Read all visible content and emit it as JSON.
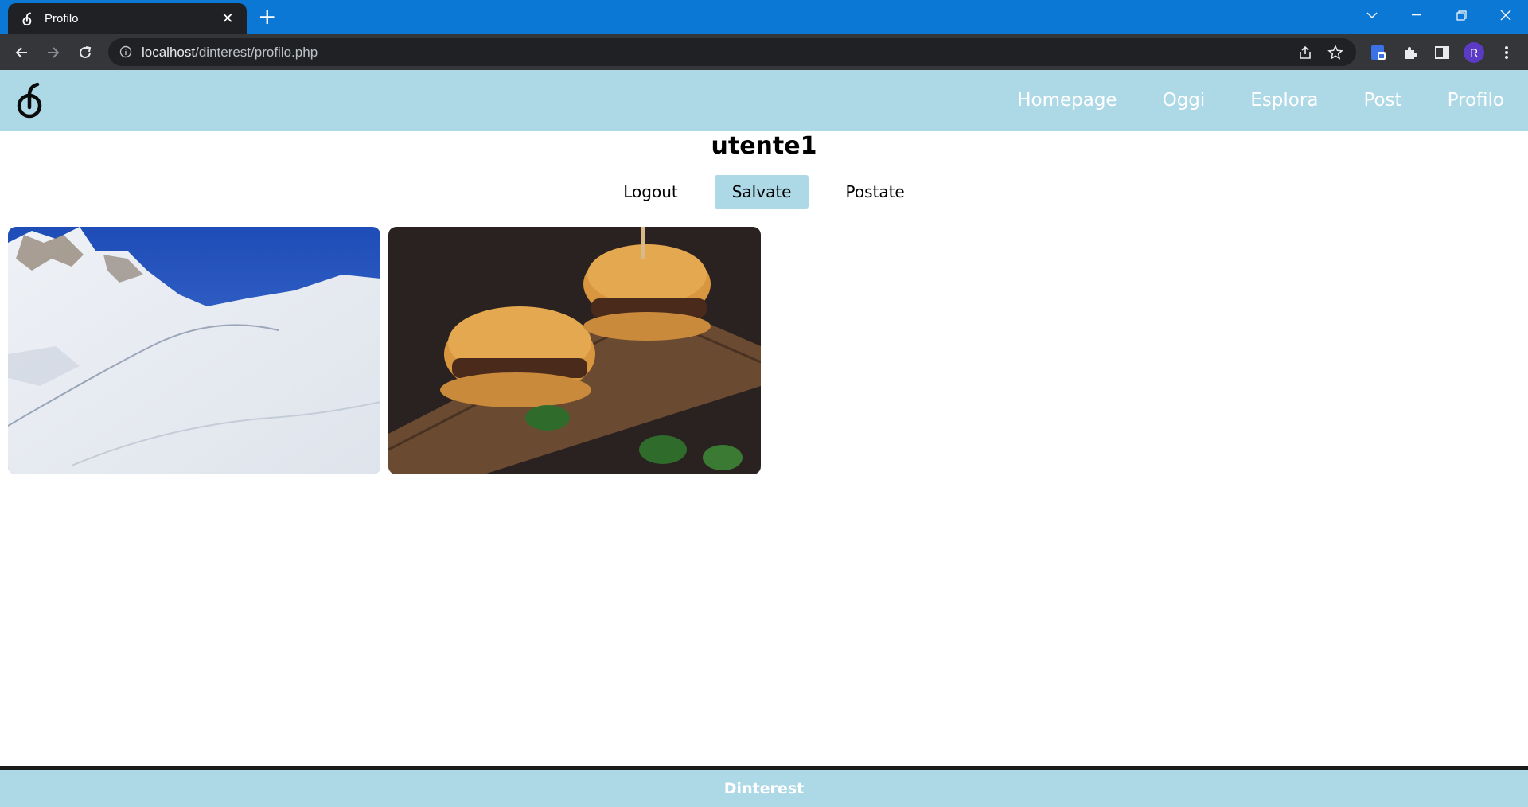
{
  "browser": {
    "tab_title": "Profilo",
    "url_host": "localhost",
    "url_path": "/dinterest/profilo.php",
    "profile_initial": "R"
  },
  "nav": {
    "links": [
      "Homepage",
      "Oggi",
      "Esplora",
      "Post",
      "Profilo"
    ]
  },
  "profile": {
    "username": "utente1",
    "tabs": [
      {
        "label": "Logout",
        "active": false
      },
      {
        "label": "Salvate",
        "active": true
      },
      {
        "label": "Postate",
        "active": false
      }
    ]
  },
  "saved_posts": [
    {
      "subject": "snowy mountain ski slope"
    },
    {
      "subject": "two burgers on a wooden board"
    }
  ],
  "footer": {
    "text": "Dinterest"
  },
  "colors": {
    "nav_background": "#add8e6",
    "titlebar": "#0a78d4",
    "footer_border": "#1b1b1b"
  }
}
